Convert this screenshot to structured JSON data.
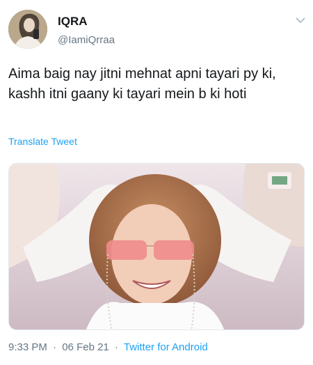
{
  "tweet": {
    "display_name": "IQRA",
    "handle": "@IamiQrraa",
    "text": "Aima baig nay jitni mehnat apni tayari py ki, kashh itni gaany ki tayari mein b ki hoti",
    "translate_label": "Translate Tweet",
    "time": "9:33 PM",
    "date": "06 Feb 21",
    "source": "Twitter for Android",
    "separator": "·"
  },
  "icons": {
    "menu_caret": "chevron-down-icon",
    "avatar": "profile-photo",
    "media": "embedded-photo"
  },
  "colors": {
    "text": "#14171a",
    "secondary": "#657786",
    "link": "#1da1f2"
  }
}
